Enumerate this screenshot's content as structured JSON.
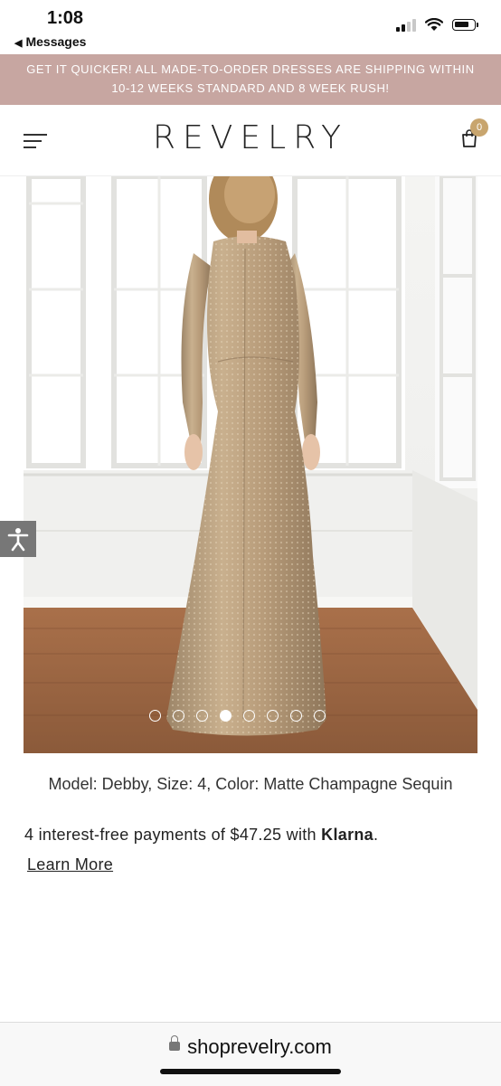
{
  "status": {
    "time": "1:08",
    "back_label": "Messages"
  },
  "promo": {
    "line1": "GET IT QUICKER! ALL MADE-TO-ORDER DRESSES ARE SHIPPING WITHIN",
    "line2": "10-12 WEEKS STANDARD AND 8 WEEK RUSH!"
  },
  "header": {
    "logo": "REVELRY",
    "cart_count": "0"
  },
  "gallery": {
    "total_slides": 8,
    "active_slide": 4
  },
  "product": {
    "caption": "Model: Debby, Size: 4, Color: Matte Champagne Sequin",
    "klarna_text": "4 interest-free payments of $47.25 with ",
    "klarna_brand": "Klarna",
    "klarna_period": ".",
    "learn_more": "Learn More"
  },
  "browser": {
    "url": "shoprevelry.com"
  },
  "colors": {
    "promo_bg": "#c7a6a1",
    "cart_badge": "#c8a56e"
  }
}
